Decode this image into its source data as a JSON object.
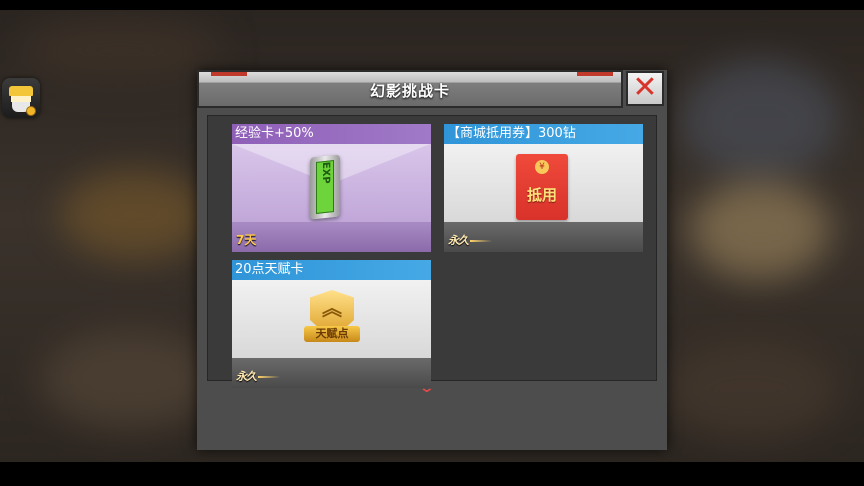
{
  "dialog": {
    "title": "幻影挑战卡",
    "close_symbol": "✕"
  },
  "cards": [
    {
      "name": "经验卡+50%",
      "duration": "7天",
      "header_color": "#9a6cc2",
      "icon": "exp-card-icon",
      "icon_text": "EXP"
    },
    {
      "name": "【商城抵用券】300钻",
      "duration": "永久",
      "header_color": "#3aa0e0",
      "icon": "red-packet-icon",
      "icon_text": "抵用",
      "icon_seal": "¥"
    },
    {
      "name": "20点天赋卡",
      "duration": "永久",
      "header_color": "#3aa0e0",
      "icon": "talent-badge-icon",
      "icon_text": "天赋点"
    }
  ],
  "scroll_indicator": "⌄"
}
